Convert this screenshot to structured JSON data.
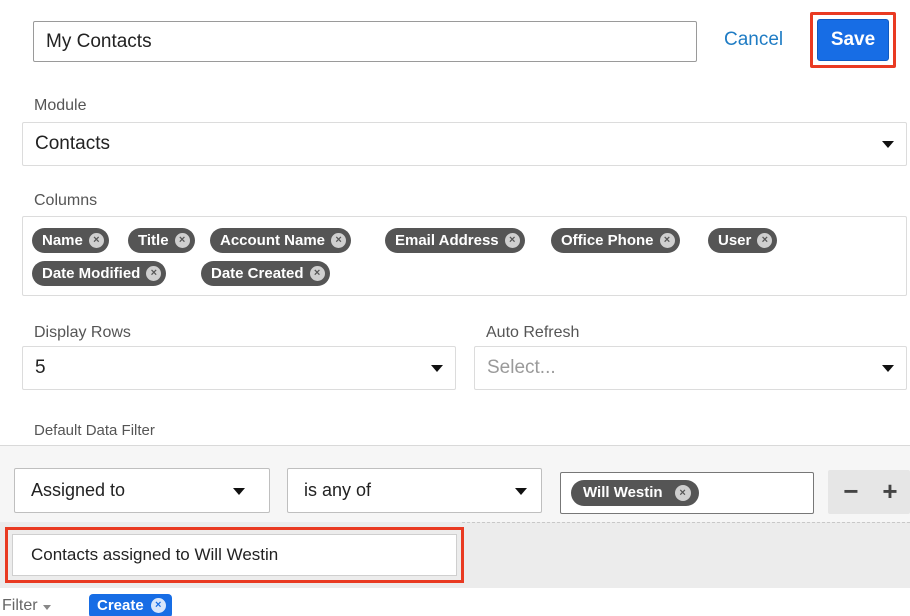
{
  "header": {
    "title_value": "My Contacts",
    "cancel_label": "Cancel",
    "save_label": "Save"
  },
  "module": {
    "label": "Module",
    "value": "Contacts"
  },
  "columns": {
    "label": "Columns",
    "items": [
      "Name",
      "Title",
      "Account Name",
      "Email Address",
      "Office Phone",
      "User",
      "Date Modified",
      "Date Created"
    ],
    "remove_glyph": "×"
  },
  "display_rows": {
    "label": "Display Rows",
    "value": "5"
  },
  "auto_refresh": {
    "label": "Auto Refresh",
    "placeholder": "Select..."
  },
  "default_filter": {
    "label": "Default Data Filter",
    "field": "Assigned to",
    "operator": "is any of",
    "value": "Will Westin",
    "remove_row": "−",
    "add_row": "+",
    "name_value": "Contacts assigned to Will Westin"
  },
  "footer": {
    "filter_label": "Filter",
    "create_label": "Create"
  },
  "colors": {
    "accent": "#176de5",
    "highlight_outline": "#e93a22",
    "pill": "#555555"
  }
}
